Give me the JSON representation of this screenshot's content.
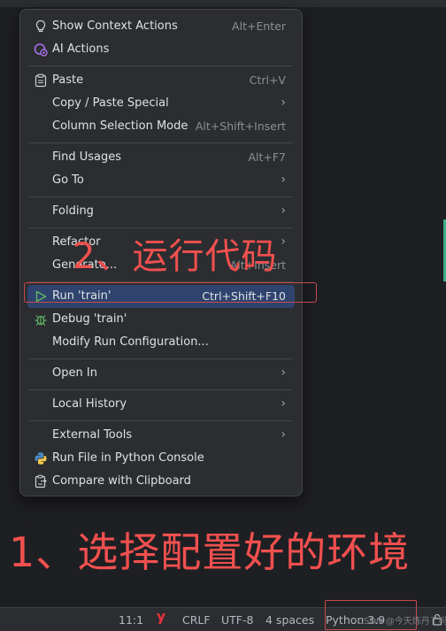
{
  "context_menu": {
    "items": [
      {
        "label": "Show Context Actions",
        "shortcut": "Alt+Enter",
        "icon": "lightbulb-icon"
      },
      {
        "label": "AI Actions",
        "shortcut": "",
        "icon": "ai-icon"
      },
      {
        "label": "Paste",
        "shortcut": "Ctrl+V",
        "icon": "clipboard-icon"
      },
      {
        "label": "Copy / Paste Special",
        "shortcut": "",
        "submenu": true
      },
      {
        "label": "Column Selection Mode",
        "shortcut": "Alt+Shift+Insert"
      },
      {
        "label": "Find Usages",
        "shortcut": "Alt+F7"
      },
      {
        "label": "Go To",
        "shortcut": "",
        "submenu": true
      },
      {
        "label": "Folding",
        "shortcut": "",
        "submenu": true
      },
      {
        "label": "Refactor",
        "shortcut": "",
        "submenu": true
      },
      {
        "label": "Generate...",
        "shortcut": "Alt+Insert"
      },
      {
        "label": "Run 'train'",
        "shortcut": "Ctrl+Shift+F10",
        "icon": "run-icon",
        "selected": true
      },
      {
        "label": "Debug 'train'",
        "shortcut": "",
        "icon": "debug-bug-icon"
      },
      {
        "label": "Modify Run Configuration...",
        "shortcut": ""
      },
      {
        "label": "Open In",
        "shortcut": "",
        "submenu": true
      },
      {
        "label": "Local History",
        "shortcut": "",
        "submenu": true
      },
      {
        "label": "External Tools",
        "shortcut": "",
        "submenu": true
      },
      {
        "label": "Run File in Python Console",
        "shortcut": "",
        "icon": "python-icon"
      },
      {
        "label": "Compare with Clipboard",
        "shortcut": "",
        "icon": "compare-clipboard-icon"
      }
    ],
    "selected_color": "#2e436e"
  },
  "annotations": {
    "step2": "2、运行代码",
    "step1": "1、选择配置好的环境",
    "color": "#f1504f"
  },
  "status_bar": {
    "position": "11:1",
    "line_ending": "CRLF",
    "encoding": "UTF-8",
    "indent": "4 spaces",
    "interpreter": "Python 3.9"
  },
  "watermark": "CSDN @今天炼丹了吗"
}
